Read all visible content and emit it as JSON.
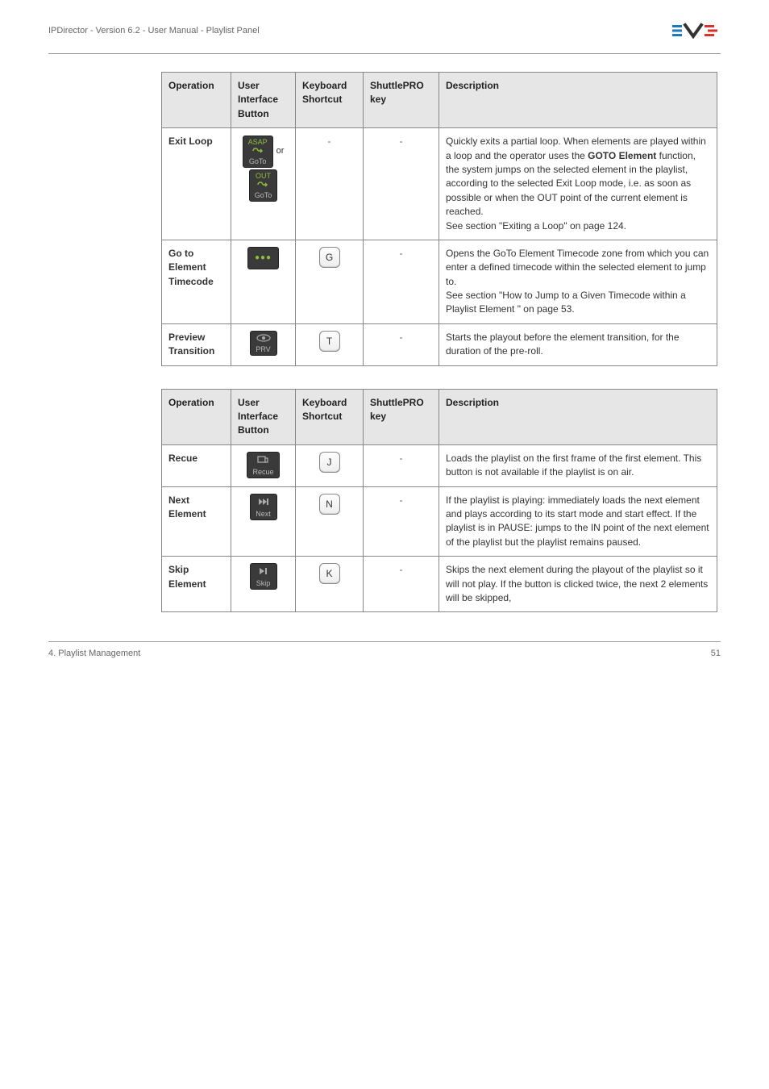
{
  "header": {
    "title": "IPDirector - Version 6.2 - User Manual - Playlist Panel",
    "logo_alt": "EVS"
  },
  "table1": {
    "headers": {
      "op": "Operation",
      "uib": "User Interface Button",
      "kb": "Keyboard Shortcut",
      "sp": "ShuttlePRO key",
      "desc": "Description"
    },
    "rows": [
      {
        "op": "Exit Loop",
        "uib_parts": {
          "asap": "ASAP",
          "goto": "GoTo",
          "or": "or",
          "out": "OUT",
          "goto2": "GoTo"
        },
        "kb": "-",
        "sp": "-",
        "desc_parts": {
          "p1": "Quickly exits a partial loop. When elements are played within a loop and the operator uses the ",
          "bold": "GOTO Element",
          "p2": " function, the system jumps on the selected element in the playlist, according to the selected Exit Loop mode, i.e. as soon as possible or when the OUT point of the current element is reached.",
          "p3": "See section \"Exiting a Loop\" on page 124."
        }
      },
      {
        "op": "Go to Element Timecode",
        "key": "G",
        "kb": "-",
        "sp": "-",
        "desc_parts": {
          "p1": "Opens the GoTo Element Timecode zone from which you can enter a defined timecode within the selected element to jump to.",
          "p2": "See section \"How to Jump to a Given Timecode within a Playlist Element \" on page 53."
        }
      },
      {
        "op": "Preview Transition",
        "uib_label": "PRV",
        "key": "T",
        "kb": "-",
        "sp": "-",
        "desc": "Starts the playout before the element transition, for the duration of the pre-roll."
      }
    ]
  },
  "table2": {
    "headers": {
      "op": "Operation",
      "uib": "User Interface Button",
      "kb": "Keyboard Shortcut",
      "sp": "ShuttlePRO key",
      "desc": "Description"
    },
    "rows": [
      {
        "op": "Recue",
        "uib_label": "Recue",
        "key": "J",
        "sp": "-",
        "desc": "Loads the playlist on the first frame of the first element. This button is not available if the playlist is on air."
      },
      {
        "op": "Next Element",
        "uib_label": "Next",
        "key": "N",
        "sp": "-",
        "desc": "If the playlist is playing: immediately loads the next element and plays according to its start mode and start effect. If the playlist is in PAUSE: jumps to the IN point of the next element of the playlist but the playlist remains paused."
      },
      {
        "op": "Skip Element",
        "uib_label": "Skip",
        "key": "K",
        "sp": "-",
        "desc": "Skips the next element during the playout of the playlist so it will not play. If the button is clicked twice, the next 2 elements will be skipped,"
      }
    ]
  },
  "footer": {
    "left": "4. Playlist Management",
    "right": "51"
  }
}
